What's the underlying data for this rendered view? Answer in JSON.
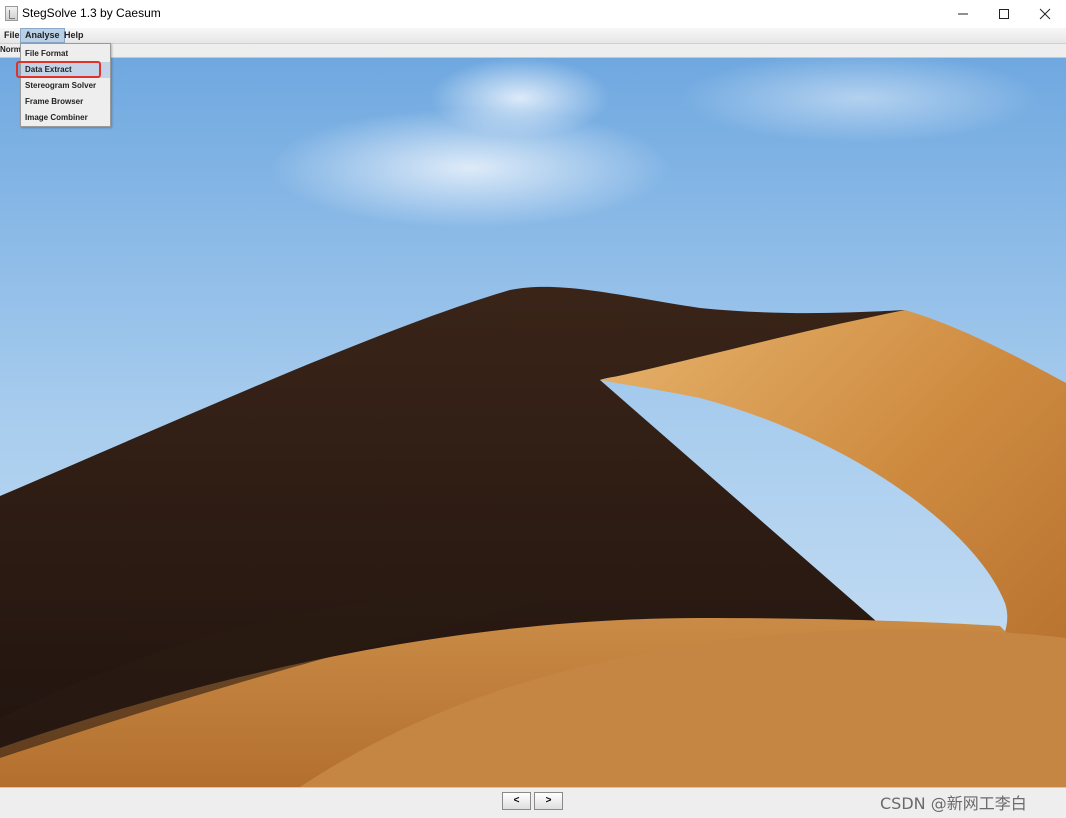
{
  "window": {
    "title": "StegSolve 1.3 by Caesum"
  },
  "menubar": {
    "file": "File",
    "analyse": "Analyse",
    "help": "Help"
  },
  "mode_label": "Norm",
  "analyse_menu": {
    "items": [
      "File Format",
      "Data Extract",
      "Stereogram Solver",
      "Frame Browser",
      "Image Combiner"
    ],
    "highlighted": "Data Extract"
  },
  "navigation": {
    "prev": "<",
    "next": ">"
  },
  "watermark": "CSDN @新网工李白",
  "colors": {
    "highlight_border": "#e0322a",
    "menu_active": "#b8cfe5"
  },
  "image": {
    "description_icon": "desert-dune-image"
  }
}
